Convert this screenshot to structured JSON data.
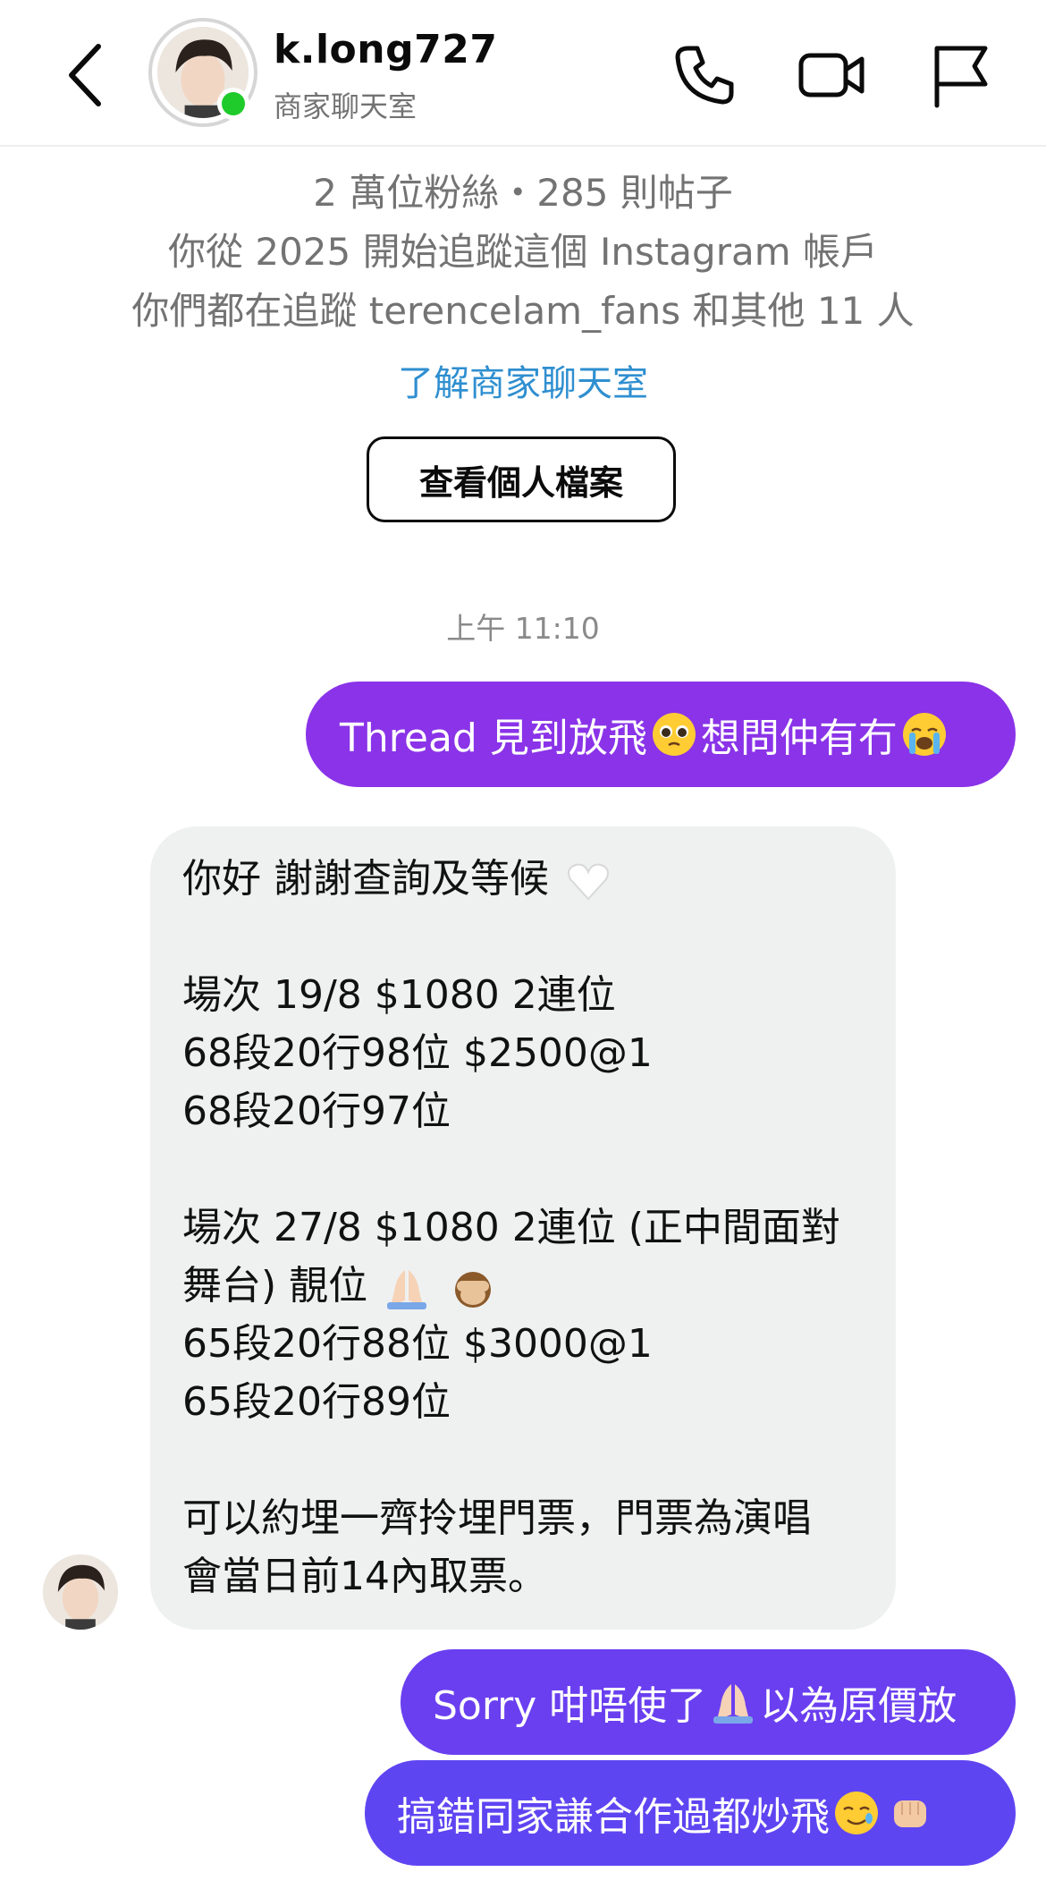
{
  "header": {
    "back_icon": "chevron-left-icon",
    "username": "k.long727",
    "subtitle": "商家聊天室",
    "icons": [
      "phone-icon",
      "video-icon",
      "flag-icon"
    ],
    "online_color": "#1ecb2b"
  },
  "profile": {
    "stats": "2 萬位粉絲・285 則帖子",
    "follow_since": "你從 2025 開始追蹤這個 Instagram 帳戶",
    "mutual": "你們都在追蹤 terencelam_fans 和其他 11 人",
    "learn_link": "了解商家聊天室",
    "view_profile_button": "查看個人檔案"
  },
  "timestamp": "上午 11:10",
  "messages": {
    "out1": {
      "text_a": "Thread 見到放飛",
      "emoji_a": "pleading-face-emoji",
      "text_b": "想問仲有冇",
      "emoji_b": "crying-face-emoji",
      "color": "#8a33e8"
    },
    "in1": {
      "line1": "你好 謝謝查詢及等候",
      "line1_emoji": "white-heart-emoji",
      "line2": "場次 19/8  $1080 2連位",
      "line3": "68段20行98位 $2500@1",
      "line4": "68段20行97位",
      "line5": "場次 27/8 $1080 2連位 (正中間面對",
      "line6": "舞台) 靚位",
      "line6_emojis": [
        "folded-hands-emoji",
        "see-no-evil-monkey-emoji"
      ],
      "line7": "65段20行88位 $3000@1",
      "line8": "65段20行89位",
      "line9": "可以約埋一齊拎埋門票，門票為演唱",
      "line10": "會當日前14內取票。"
    },
    "out2": {
      "text_a": "Sorry 咁唔使了",
      "emoji": "folded-hands-emoji",
      "text_b": "以為原價放",
      "color": "#6a3ff0"
    },
    "out3": {
      "text": "搞錯同家謙合作過都炒飛",
      "emojis": [
        "smiling-face-with-tear-emoji",
        "oncoming-fist-emoji"
      ],
      "color": "#5e45f2"
    }
  }
}
